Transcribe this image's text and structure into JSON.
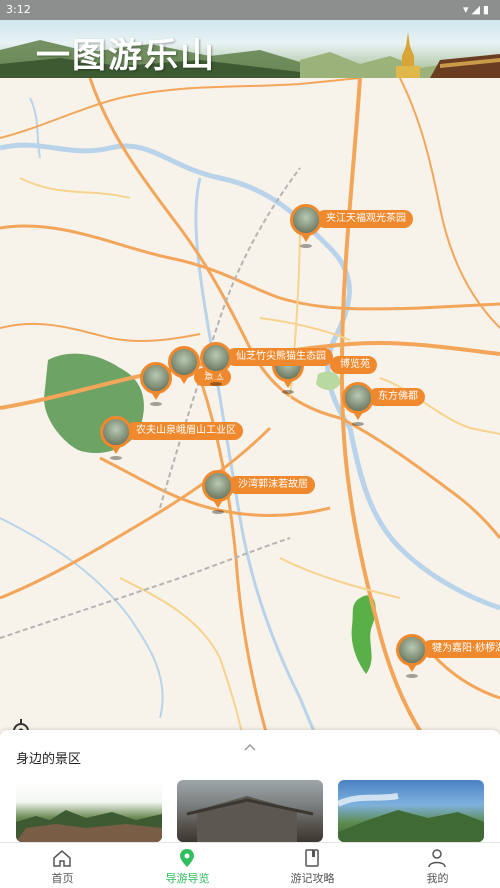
{
  "status_bar": {
    "time": "3:12",
    "icons": "▾◢▮"
  },
  "banner": {
    "title": "一图游乐山"
  },
  "map": {
    "pois": [
      {
        "id": "jiajiang",
        "label": "夹江天福观光茶园"
      },
      {
        "id": "xianzhi",
        "label": "仙芝竹尖熊猫生态园"
      },
      {
        "id": "bolanyuan",
        "label": "博览苑"
      },
      {
        "id": "scenic-area",
        "label": "景区"
      },
      {
        "id": "dongfang",
        "label": "东方佛都"
      },
      {
        "id": "nongfu",
        "label": "农夫山泉峨眉山工业区"
      },
      {
        "id": "shawan",
        "label": "沙湾郭沫若故居"
      },
      {
        "id": "qianwei",
        "label": "犍为嘉阳·桫椤湖"
      }
    ],
    "locate_icon": "crosshair-icon"
  },
  "panel": {
    "title": "身边的景区",
    "handle_icon": "chevron-up-icon"
  },
  "tabs": [
    {
      "id": "home",
      "label": "首页",
      "icon": "home-icon",
      "active": false
    },
    {
      "id": "guide",
      "label": "导游导览",
      "icon": "location-pin-icon",
      "active": true
    },
    {
      "id": "notes",
      "label": "游记攻略",
      "icon": "book-icon",
      "active": false
    },
    {
      "id": "mine",
      "label": "我的",
      "icon": "user-icon",
      "active": false
    }
  ],
  "colors": {
    "accent": "#f0892d",
    "active_tab": "#2fbf5f",
    "road": "#f3a65a",
    "water": "#b9d3ea"
  }
}
